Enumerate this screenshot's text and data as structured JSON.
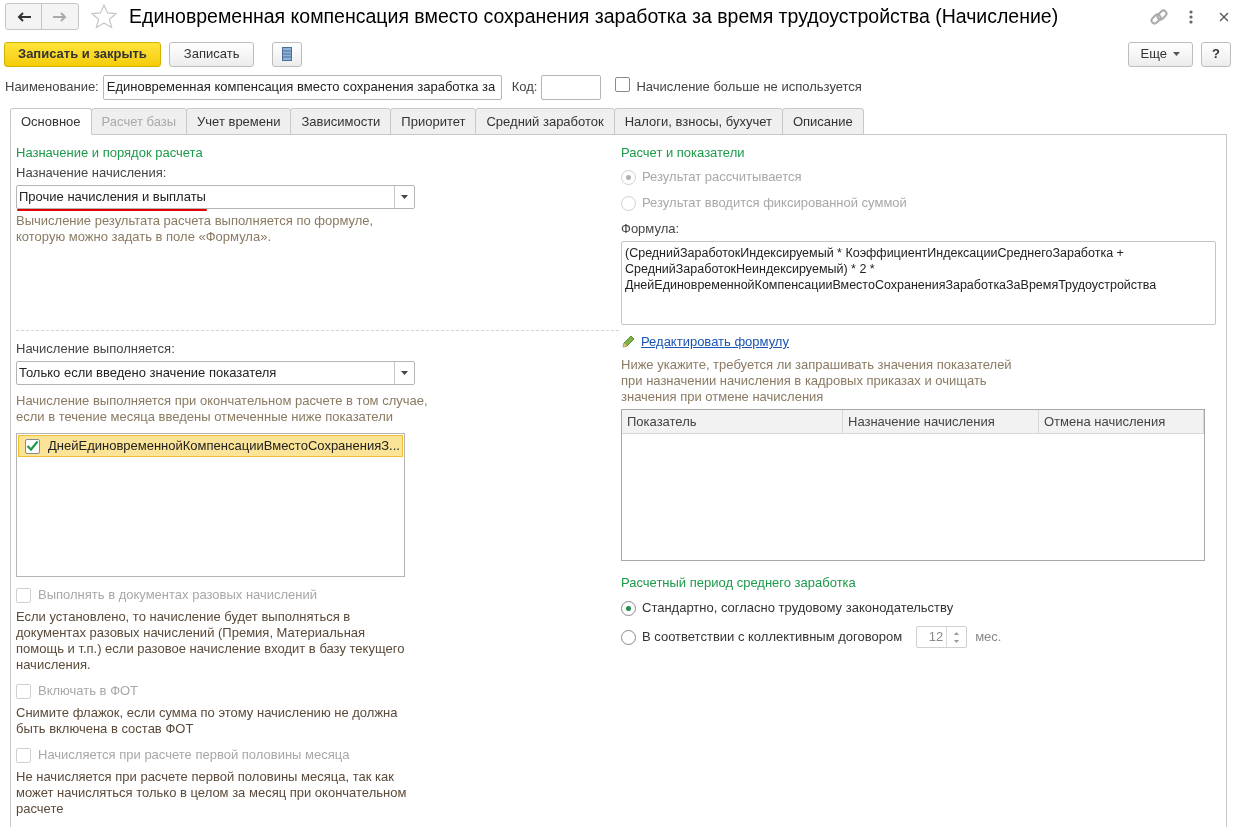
{
  "window": {
    "title": "Единовременная компенсация вместо сохранения заработка за время трудоустройства (Начисление)"
  },
  "toolbar": {
    "buttons": [
      {
        "label": "Записать и закрыть",
        "kind": "primary"
      },
      {
        "label": "Записать",
        "kind": "normal"
      }
    ],
    "more_button": "Еще",
    "help_button": "?"
  },
  "name_row": {
    "label": "Наименование:",
    "value": "Единовременная компенсация вместо сохранения заработка за",
    "code_label": "Код:",
    "not_used": {
      "label": "Начисление больше не используется",
      "checked": false
    }
  },
  "tabs": [
    {
      "label": "Основное",
      "selected": true,
      "disabled": false
    },
    {
      "label": "Расчет базы",
      "selected": false,
      "disabled": true
    },
    {
      "label": "Учет времени",
      "selected": false,
      "disabled": false
    },
    {
      "label": "Зависимости",
      "selected": false,
      "disabled": false
    },
    {
      "label": "Приоритет",
      "selected": false,
      "disabled": false
    },
    {
      "label": "Средний заработок",
      "selected": false,
      "disabled": false
    },
    {
      "label": "Налоги, взносы, бухучет",
      "selected": false,
      "disabled": false
    },
    {
      "label": "Описание",
      "selected": false,
      "disabled": false
    }
  ],
  "left": {
    "section_title": "Назначение и порядок расчета",
    "purpose_label": "Назначение начисления:",
    "purpose_value": "Прочие начисления и выплаты",
    "purpose_hint": "Вычисление результата расчета выполняется по формуле, которую можно задать в поле «Формула».",
    "execution_label": "Начисление выполняется:",
    "execution_value": "Только если введено значение показателя",
    "execution_hint": "Начисление выполняется при окончательном расчете в том случае, если в течение месяца введены отмеченные ниже показатели",
    "indicators": [
      {
        "label": "ДнейЕдиновременнойКомпенсацииВместоСохраненияЗ...",
        "checked": true,
        "selected": true
      }
    ],
    "options": [
      {
        "label": "Выполнять в документах разовых начислений",
        "checked": false,
        "disabled": true,
        "hint": "Если установлено, то начисление будет выполняться в документах разовых начислений (Премия, Материальная помощь и т.п.) если разовое начисление входит в базу текущего начисления."
      },
      {
        "label": "Включать в ФОТ",
        "checked": false,
        "disabled": true,
        "hint": "Снимите флажок, если сумма по этому начислению не должна быть включена в состав ФОТ"
      },
      {
        "label": "Начисляется при расчете первой половины месяца",
        "checked": false,
        "disabled": true,
        "hint": "Не начисляется при расчете первой половины месяца, так как может начисляться только в целом за месяц при окончательном расчете"
      }
    ]
  },
  "right": {
    "section_title": "Расчет и показатели",
    "result_options": [
      {
        "label": "Результат рассчитывается",
        "selected": true,
        "disabled": true
      },
      {
        "label": "Результат вводится фиксированной суммой",
        "selected": false,
        "disabled": true
      }
    ],
    "formula_label": "Формула:",
    "formula_lines": [
      "(СреднийЗаработокИндексируемый * КоэффициентИндексацииСреднегоЗаработка +",
      "СреднийЗаработокНеиндексируемый) * 2 *",
      "ДнейЕдиновременнойКомпенсацииВместоСохраненияЗаработкаЗаВремяТрудоустройства"
    ],
    "edit_link": "Редактировать формулу",
    "table_hint": "Ниже укажите, требуется ли запрашивать значения показателей при назначении начисления в кадровых приказах и очищать значения при отмене начисления",
    "table": {
      "columns": [
        "Показатель",
        "Назначение начисления",
        "Отмена начисления"
      ]
    },
    "period_title": "Расчетный период среднего заработка",
    "period_options": [
      {
        "label": "Стандартно, согласно трудовому законодательству",
        "selected": true,
        "kind": "plain"
      },
      {
        "label": "В соответствии с коллективным договором",
        "selected": false,
        "kind": "months"
      }
    ],
    "months_value": "12",
    "months_unit": "мес."
  }
}
